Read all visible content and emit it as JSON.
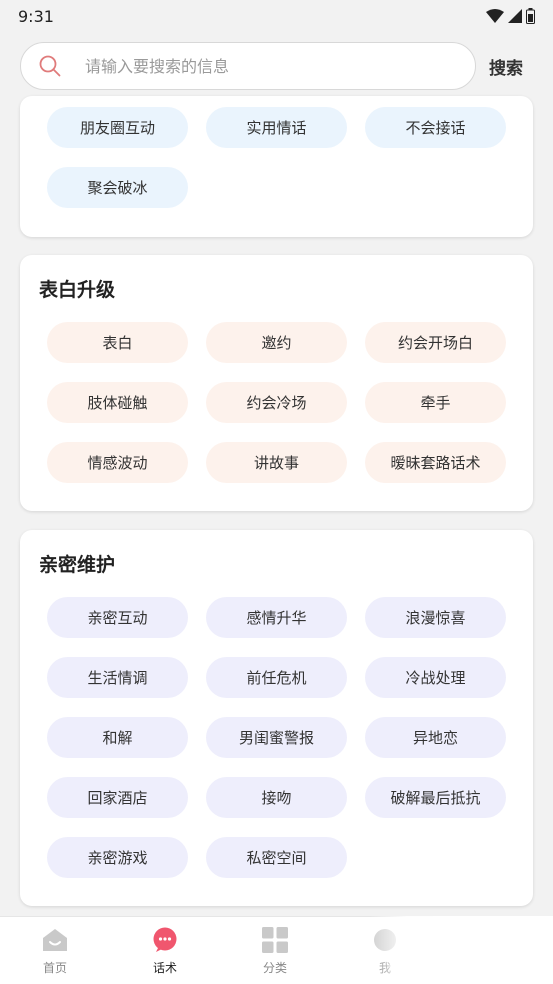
{
  "status": {
    "time": "9:31"
  },
  "search": {
    "placeholder": "请输入要搜索的信息",
    "button": "搜索"
  },
  "sections": [
    {
      "title": "",
      "chips": [
        "朋友圈互动",
        "实用情话",
        "不会接话",
        "聚会破冰"
      ]
    },
    {
      "title": "表白升级",
      "chips": [
        "表白",
        "邀约",
        "约会开场白",
        "肢体碰触",
        "约会冷场",
        "牵手",
        "情感波动",
        "讲故事",
        "暧昧套路话术"
      ]
    },
    {
      "title": "亲密维护",
      "chips": [
        "亲密互动",
        "感情升华",
        "浪漫惊喜",
        "生活情调",
        "前任危机",
        "冷战处理",
        "和解",
        "男闺蜜警报",
        "异地恋",
        "回家酒店",
        "接吻",
        "破解最后抵抗",
        "亲密游戏",
        "私密空间"
      ]
    }
  ],
  "nav": [
    {
      "label": "首页",
      "icon": "home-icon"
    },
    {
      "label": "话术",
      "icon": "chat-bubble-icon"
    },
    {
      "label": "分类",
      "icon": "grid-icon"
    },
    {
      "label": "我",
      "icon": "profile-icon"
    }
  ],
  "colors": {
    "accent": "#f0566e",
    "chip_blue": "#eaf4fd",
    "chip_peach": "#fdf2ec",
    "chip_lavender": "#eeeefc"
  }
}
